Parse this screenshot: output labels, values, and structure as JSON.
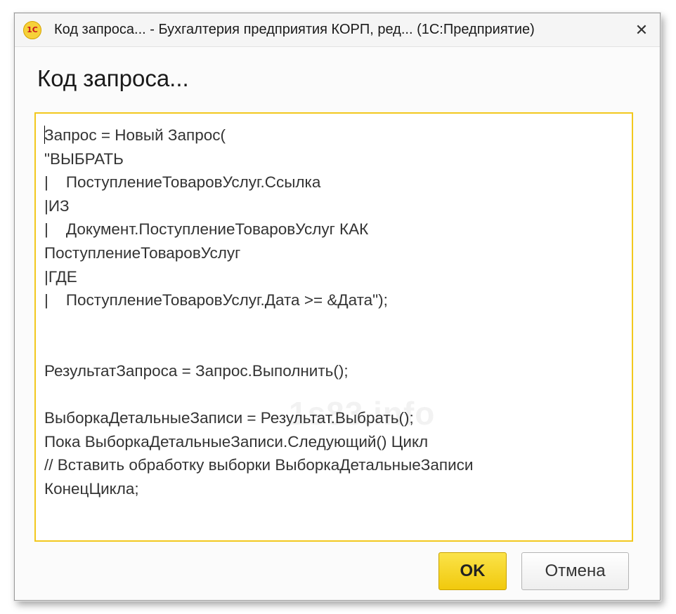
{
  "window": {
    "title": "Код запроса... - Бухгалтерия предприятия КОРП, ред...  (1С:Предприятие)",
    "icon": "1c-logo-icon",
    "icon_text": "1С",
    "close_glyph": "✕"
  },
  "dialog": {
    "heading": "Код запроса..."
  },
  "editor": {
    "lines": [
      "Запрос = Новый Запрос(",
      "\"ВЫБРАТЬ",
      "|    ПоступлениеТоваровУслуг.Ссылка",
      "|ИЗ",
      "|    Документ.ПоступлениеТоваровУслуг КАК",
      "ПоступлениеТоваровУслуг",
      "|ГДЕ",
      "|    ПоступлениеТоваровУслуг.Дата >= &Дата\");",
      "",
      "",
      "РезультатЗапроса = Запрос.Выполнить();",
      "",
      "ВыборкаДетальныеЗаписи = Результат.Выбрать();",
      "Пока ВыборкаДетальныеЗаписи.Следующий() Цикл",
      "// Вставить обработку выборки ВыборкаДетальныеЗаписи",
      "КонецЦикла;"
    ],
    "watermark": "1s83.info"
  },
  "buttons": {
    "ok_label": "OK",
    "cancel_label": "Отмена"
  },
  "colors": {
    "accent_yellow": "#f2c81e",
    "ok_button": "#f1c90d"
  }
}
